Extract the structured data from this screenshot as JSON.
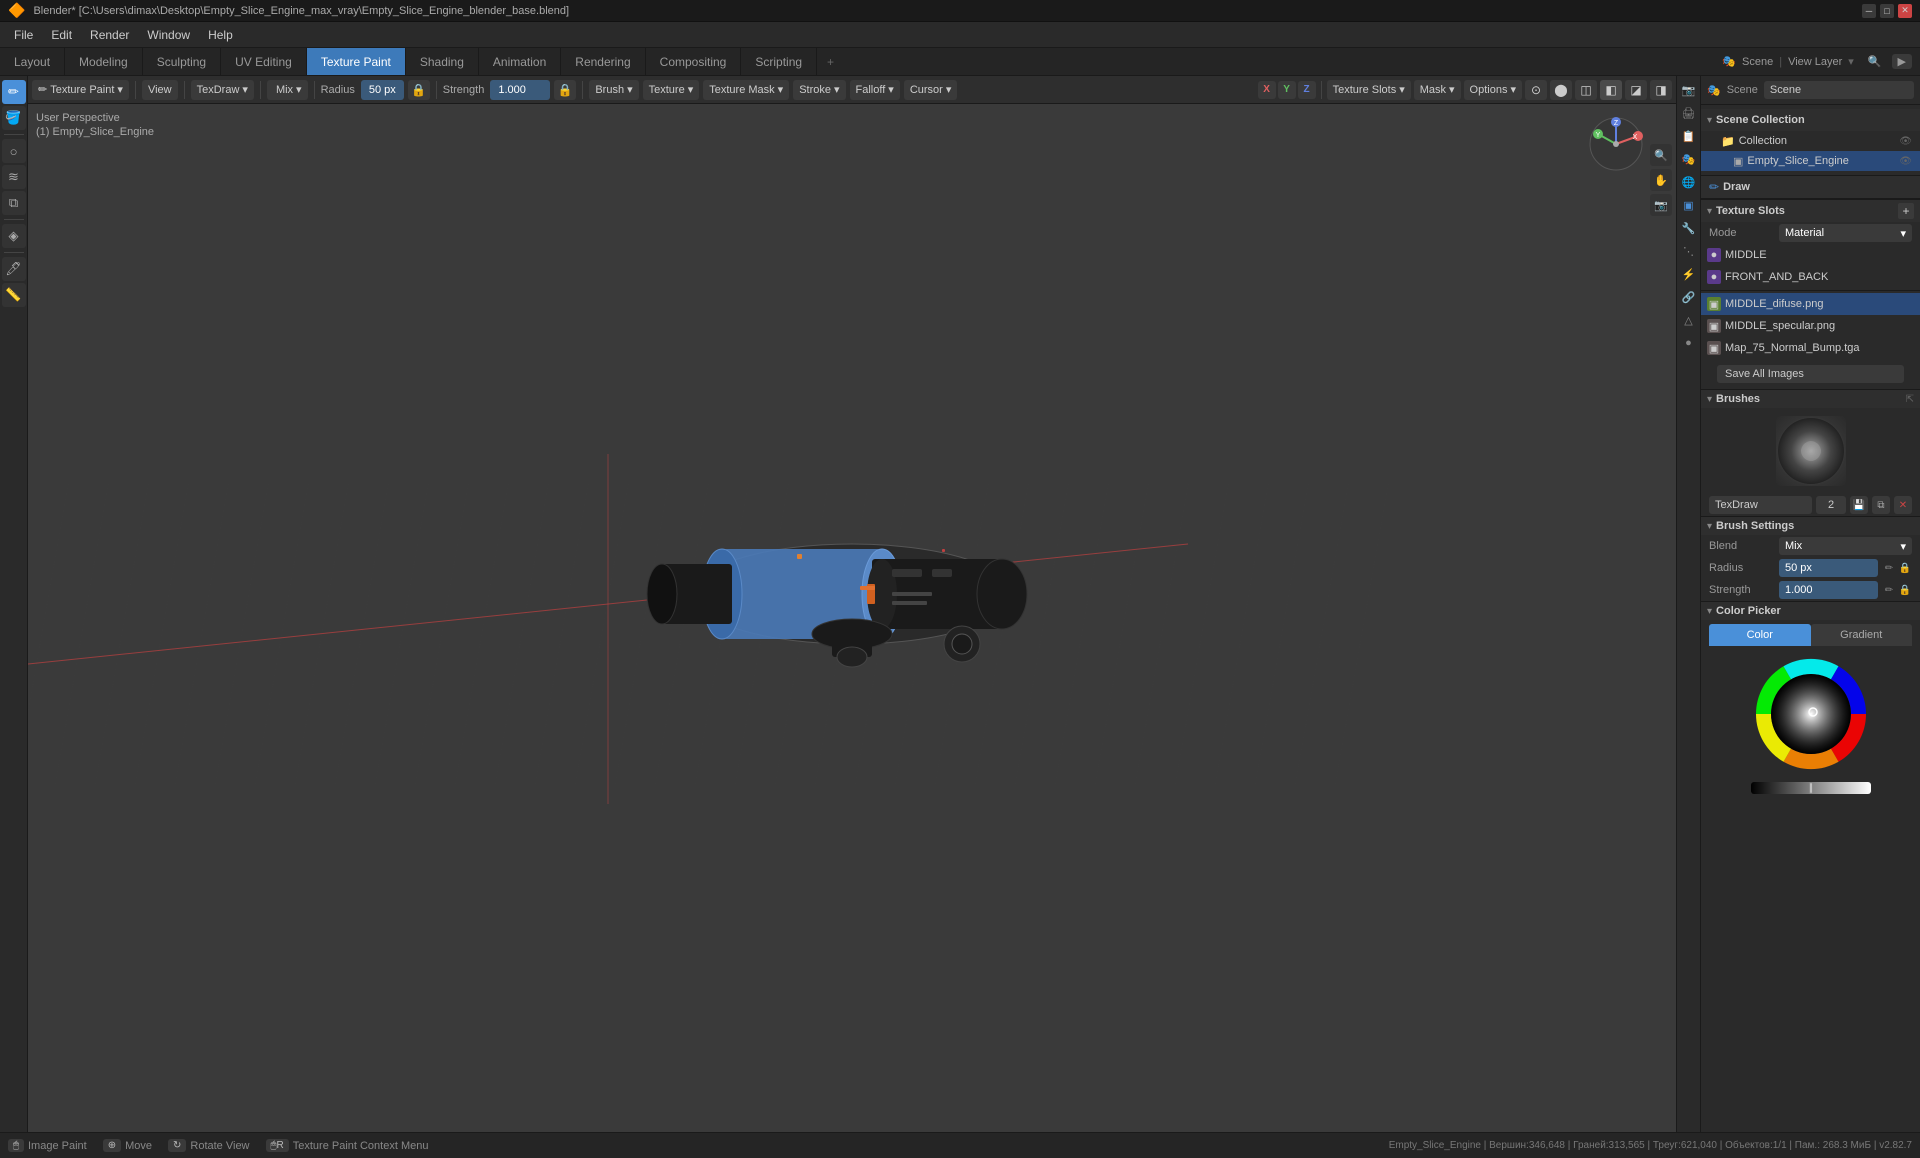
{
  "window": {
    "title": "Blender* [C:\\Users\\dimax\\Desktop\\Empty_Slice_Engine_max_vray\\Empty_Slice_Engine_blender_base.blend]",
    "logo": "🔶"
  },
  "menu": {
    "items": [
      "File",
      "Edit",
      "Render",
      "Window",
      "Help"
    ]
  },
  "workspace_tabs": {
    "tabs": [
      "Layout",
      "Modeling",
      "Sculpting",
      "UV Editing",
      "Texture Paint",
      "Shading",
      "Animation",
      "Rendering",
      "Compositing",
      "Scripting"
    ],
    "active": "Texture Paint",
    "plus_label": "+",
    "right_label": "View Layer"
  },
  "viewport_header": {
    "mode_label": "Texture Paint",
    "view_label": "View",
    "brush_preset": "TexDraw",
    "blend_label": "Mix",
    "radius_label": "Radius",
    "radius_value": "50 px",
    "strength_label": "Strength",
    "strength_value": "1.000",
    "brush_label": "Brush",
    "texture_label": "Texture",
    "texture_mask_label": "Texture Mask",
    "stroke_label": "Stroke",
    "falloff_label": "Falloff",
    "cursor_label": "Cursor",
    "coords": [
      "X",
      "Y",
      "Z"
    ],
    "texture_slots_label": "Texture Slots",
    "mask_label": "Mask",
    "options_label": "Options"
  },
  "viewport": {
    "perspective_label": "User Perspective",
    "object_label": "(1) Empty_Slice_Engine",
    "brush_icon": "✏"
  },
  "scene": {
    "label": "Scene",
    "name": "Scene",
    "view_layer_label": "View Layer",
    "view_layer_name": "View Layer"
  },
  "outliner": {
    "title": "Scene Collection",
    "collection_label": "Collection",
    "collection_name": "Collection",
    "items": [
      {
        "name": "Empty_Slice_Engine",
        "selected": true,
        "icon": "▣",
        "visible": true
      }
    ]
  },
  "properties": {
    "draw_label": "Draw",
    "texture_slots_title": "Texture Slots",
    "mode_label": "Mode",
    "mode_value": "Material",
    "textures": [
      {
        "name": "MIDDLE",
        "type": "material"
      },
      {
        "name": "FRONT_AND_BACK",
        "type": "material"
      },
      {
        "name": "MIDDLE_difuse.png",
        "type": "image",
        "selected": true
      },
      {
        "name": "MIDDLE_specular.png",
        "type": "image"
      },
      {
        "name": "Map_75_Normal_Bump.tga",
        "type": "image"
      }
    ],
    "save_all_label": "Save All Images",
    "brushes_title": "Brushes",
    "brush_name": "TexDraw",
    "brush_number": "2",
    "brush_settings_title": "Brush Settings",
    "blend_label": "Blend",
    "blend_value": "Mix",
    "radius_label": "Radius",
    "radius_value": "50 px",
    "strength_label": "Strength",
    "strength_value": "1.000",
    "color_picker_title": "Color Picker",
    "color_tab": "Color",
    "gradient_tab": "Gradient"
  },
  "status_bar": {
    "image_paint_label": "Image Paint",
    "mouse_icon": "🖱",
    "move_label": "Move",
    "rotate_label": "Rotate View",
    "context_menu_label": "Texture Paint Context Menu",
    "stats": "Empty_Slice_Engine | Вершин:346,648 | Граней:313,565 | Треуг:621,040 | Объектов:1/1 | Пам.: 268.3 МиБ | v2.82.7"
  },
  "icons": {
    "draw": "✏",
    "texture": "🗂",
    "camera": "📷",
    "render": "🎬",
    "light": "💡",
    "material": "●",
    "world": "🌐",
    "object": "▣",
    "modifier": "🔧",
    "particle": "⋰",
    "physics": "⚡",
    "constraint": "🔗",
    "scene": "🎭",
    "chevron_down": "▾",
    "chevron_right": "▸",
    "eye": "👁",
    "lock": "🔒",
    "arrow_right": "▸"
  }
}
